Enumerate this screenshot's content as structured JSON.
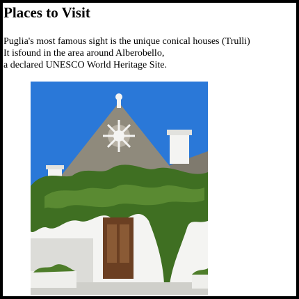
{
  "page": {
    "title": "Places to Visit",
    "description_lines": [
      "Puglia's most famous sight is the unique conical houses (Trulli)",
      "It isfound in the area around Alberobello,",
      "a declared UNESCO World Heritage Site."
    ],
    "image_subject": "trullo-house-photo"
  },
  "colors": {
    "border": "#000000",
    "sky": "#2a78d8",
    "stone_roof": "#8f8a7c",
    "whitewash": "#f4f4f2",
    "foliage": "#3f6f22",
    "door": "#6b3f22"
  }
}
